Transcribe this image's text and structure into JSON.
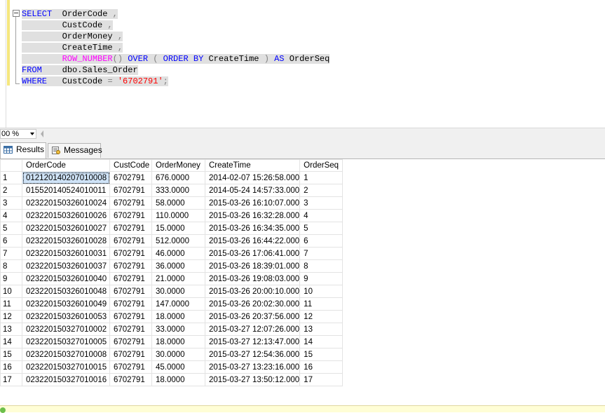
{
  "editor": {
    "lines": [
      [
        {
          "t": "SELECT",
          "c": "kw"
        },
        {
          "t": "  OrderCode ",
          "c": "id"
        },
        {
          "t": ",",
          "c": "op"
        }
      ],
      [
        {
          "t": "        CustCode ",
          "c": "id"
        },
        {
          "t": ",",
          "c": "op"
        }
      ],
      [
        {
          "t": "        OrderMoney ",
          "c": "id"
        },
        {
          "t": ",",
          "c": "op"
        }
      ],
      [
        {
          "t": "        CreateTime ",
          "c": "id"
        },
        {
          "t": ",",
          "c": "op"
        }
      ],
      [
        {
          "t": "        ",
          "c": "id"
        },
        {
          "t": "ROW_NUMBER",
          "c": "fn"
        },
        {
          "t": "() ",
          "c": "op"
        },
        {
          "t": "OVER",
          "c": "kw"
        },
        {
          "t": " ( ",
          "c": "op"
        },
        {
          "t": "ORDER BY",
          "c": "kw"
        },
        {
          "t": " CreateTime ",
          "c": "id"
        },
        {
          "t": ")",
          "c": "op"
        },
        {
          "t": " AS",
          "c": "kw"
        },
        {
          "t": " OrderSeq",
          "c": "id"
        }
      ],
      [
        {
          "t": "FROM",
          "c": "kw"
        },
        {
          "t": "    dbo.Sales_Order",
          "c": "id"
        }
      ],
      [
        {
          "t": "WHERE",
          "c": "kw"
        },
        {
          "t": "   CustCode ",
          "c": "id"
        },
        {
          "t": "=",
          "c": "op"
        },
        {
          "t": " ",
          "c": "id"
        },
        {
          "t": "'6702791'",
          "c": "str"
        },
        {
          "t": ";",
          "c": "op"
        }
      ]
    ]
  },
  "zoom": {
    "value": "00 %"
  },
  "tabs": {
    "results": "Results",
    "messages": "Messages"
  },
  "grid": {
    "columns": [
      "OrderCode",
      "CustCode",
      "OrderMoney",
      "CreateTime",
      "OrderSeq"
    ],
    "rows": [
      [
        "1",
        "012120140207010008",
        "6702791",
        "676.0000",
        "2014-02-07 15:26:58.000",
        "1"
      ],
      [
        "2",
        "015520140524010011",
        "6702791",
        "333.0000",
        "2014-05-24 14:57:33.000",
        "2"
      ],
      [
        "3",
        "023220150326010024",
        "6702791",
        "58.0000",
        "2015-03-26 16:10:07.000",
        "3"
      ],
      [
        "4",
        "023220150326010026",
        "6702791",
        "110.0000",
        "2015-03-26 16:32:28.000",
        "4"
      ],
      [
        "5",
        "023220150326010027",
        "6702791",
        "15.0000",
        "2015-03-26 16:34:35.000",
        "5"
      ],
      [
        "6",
        "023220150326010028",
        "6702791",
        "512.0000",
        "2015-03-26 16:44:22.000",
        "6"
      ],
      [
        "7",
        "023220150326010031",
        "6702791",
        "46.0000",
        "2015-03-26 17:06:41.000",
        "7"
      ],
      [
        "8",
        "023220150326010037",
        "6702791",
        "36.0000",
        "2015-03-26 18:39:01.000",
        "8"
      ],
      [
        "9",
        "023220150326010040",
        "6702791",
        "21.0000",
        "2015-03-26 19:08:03.000",
        "9"
      ],
      [
        "10",
        "023220150326010048",
        "6702791",
        "30.0000",
        "2015-03-26 20:00:10.000",
        "10"
      ],
      [
        "11",
        "023220150326010049",
        "6702791",
        "147.0000",
        "2015-03-26 20:02:30.000",
        "11"
      ],
      [
        "12",
        "023220150326010053",
        "6702791",
        "18.0000",
        "2015-03-26 20:37:56.000",
        "12"
      ],
      [
        "13",
        "023220150327010002",
        "6702791",
        "33.0000",
        "2015-03-27 12:07:26.000",
        "13"
      ],
      [
        "14",
        "023220150327010005",
        "6702791",
        "18.0000",
        "2015-03-27 12:13:47.000",
        "14"
      ],
      [
        "15",
        "023220150327010008",
        "6702791",
        "30.0000",
        "2015-03-27 12:54:36.000",
        "15"
      ],
      [
        "16",
        "023220150327010015",
        "6702791",
        "45.0000",
        "2015-03-27 13:23:16.000",
        "16"
      ],
      [
        "17",
        "023220150327010016",
        "6702791",
        "18.0000",
        "2015-03-27 13:50:12.000",
        "17"
      ]
    ]
  },
  "icons": {
    "results_tab": "grid-icon",
    "messages_tab": "messages-icon"
  },
  "colors": {
    "keyword": "#0000ff",
    "function": "#ff00ff",
    "string": "#ff0000",
    "selection": "#cfe3f7"
  }
}
